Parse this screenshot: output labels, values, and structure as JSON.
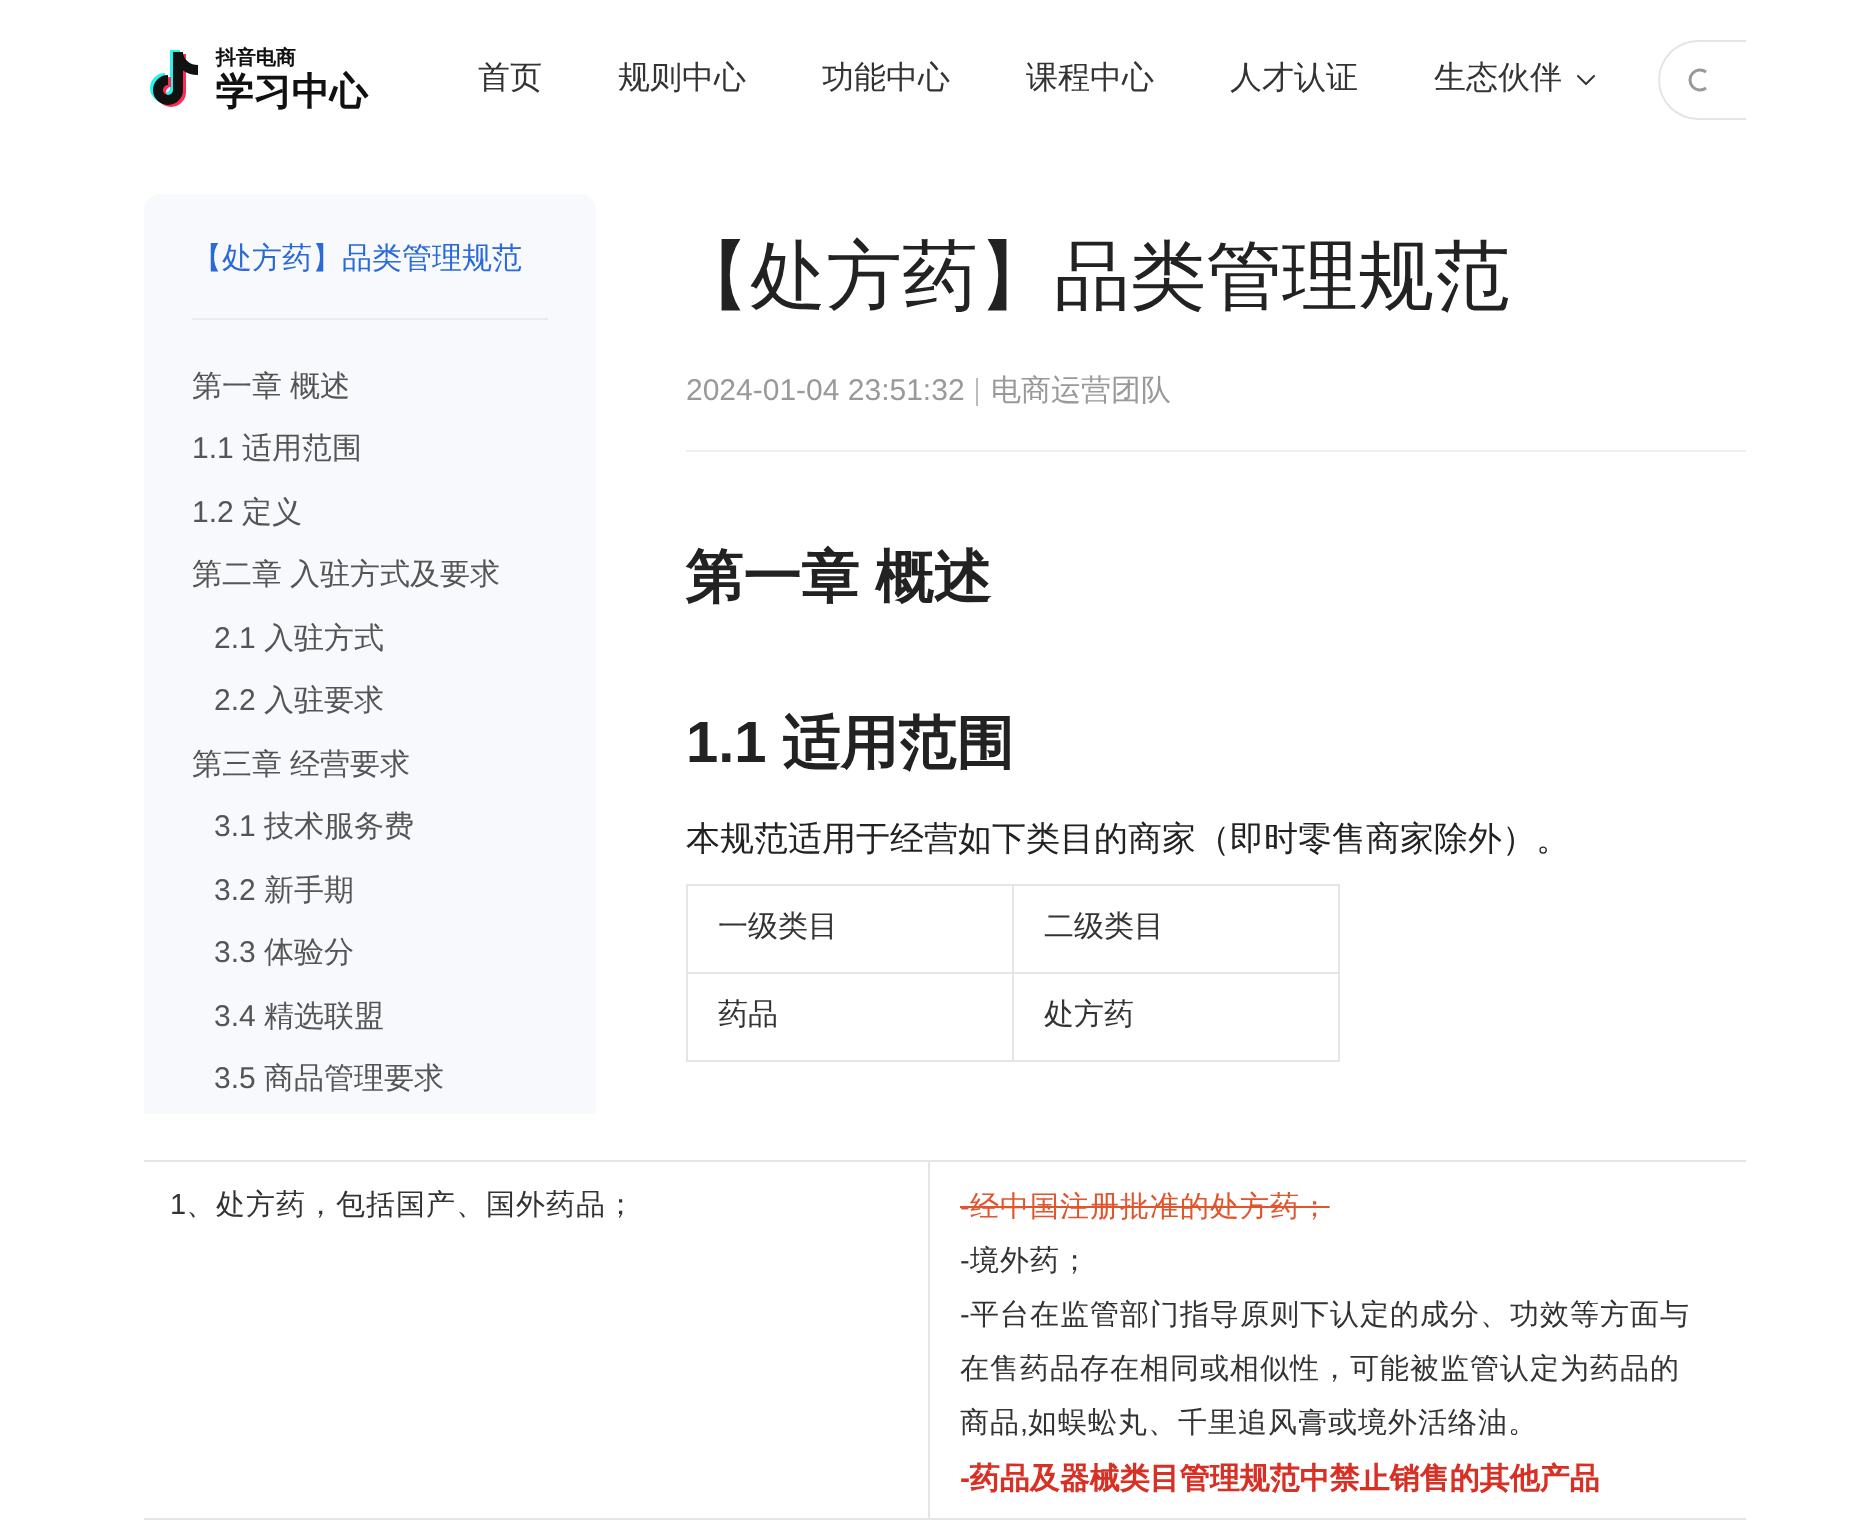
{
  "header": {
    "logo": {
      "subtitle": "抖音电商",
      "title": "学习中心"
    },
    "nav": [
      {
        "label": "首页",
        "dropdown": false
      },
      {
        "label": "规则中心",
        "dropdown": false
      },
      {
        "label": "功能中心",
        "dropdown": false
      },
      {
        "label": "课程中心",
        "dropdown": false
      },
      {
        "label": "人才认证",
        "dropdown": false
      },
      {
        "label": "生态伙伴",
        "dropdown": true
      }
    ]
  },
  "toc": {
    "title": "【处方药】品类管理规范",
    "items": [
      {
        "label": "第一章 概述"
      },
      {
        "label": "1.1 适用范围"
      },
      {
        "label": "1.2 定义"
      },
      {
        "label": "第二章 入驻方式及要求",
        "children": [
          {
            "label": "2.1 入驻方式"
          },
          {
            "label": "2.2 入驻要求"
          }
        ]
      },
      {
        "label": "第三章 经营要求",
        "children": [
          {
            "label": "3.1 技术服务费"
          },
          {
            "label": "3.2 新手期"
          },
          {
            "label": "3.3 体验分"
          },
          {
            "label": "3.4 精选联盟"
          },
          {
            "label": "3.5 商品管理要求"
          }
        ]
      }
    ]
  },
  "article": {
    "title": "【处方药】品类管理规范",
    "date": "2024-01-04 23:51:32",
    "author": "电商运营团队",
    "chapter_heading": "第一章 概述",
    "section_heading": "1.1 适用范围",
    "paragraph": "本规范适用于经营如下类目的商家（即时零售商家除外）。",
    "table": {
      "columns": [
        "一级类目",
        "二级类目"
      ],
      "rows": [
        [
          "药品",
          "处方药"
        ]
      ]
    }
  },
  "lower_table": {
    "left": "1、处方药，包括国产、国外药品；",
    "right_lines": [
      {
        "kind": "struck",
        "text": "-经中国注册批准的处方药；"
      },
      {
        "kind": "normal",
        "text": "-境外药；"
      },
      {
        "kind": "normal",
        "text": "-平台在监管部门指导原则下认定的成分、功效等方面与在售药品存在相同或相似性，可能被监管认定为药品的商品,如蜈蚣丸、千里追风膏或境外活络油。"
      },
      {
        "kind": "emphasis",
        "text": "-药品及器械类目管理规范中禁止销售的其他产品"
      }
    ]
  }
}
